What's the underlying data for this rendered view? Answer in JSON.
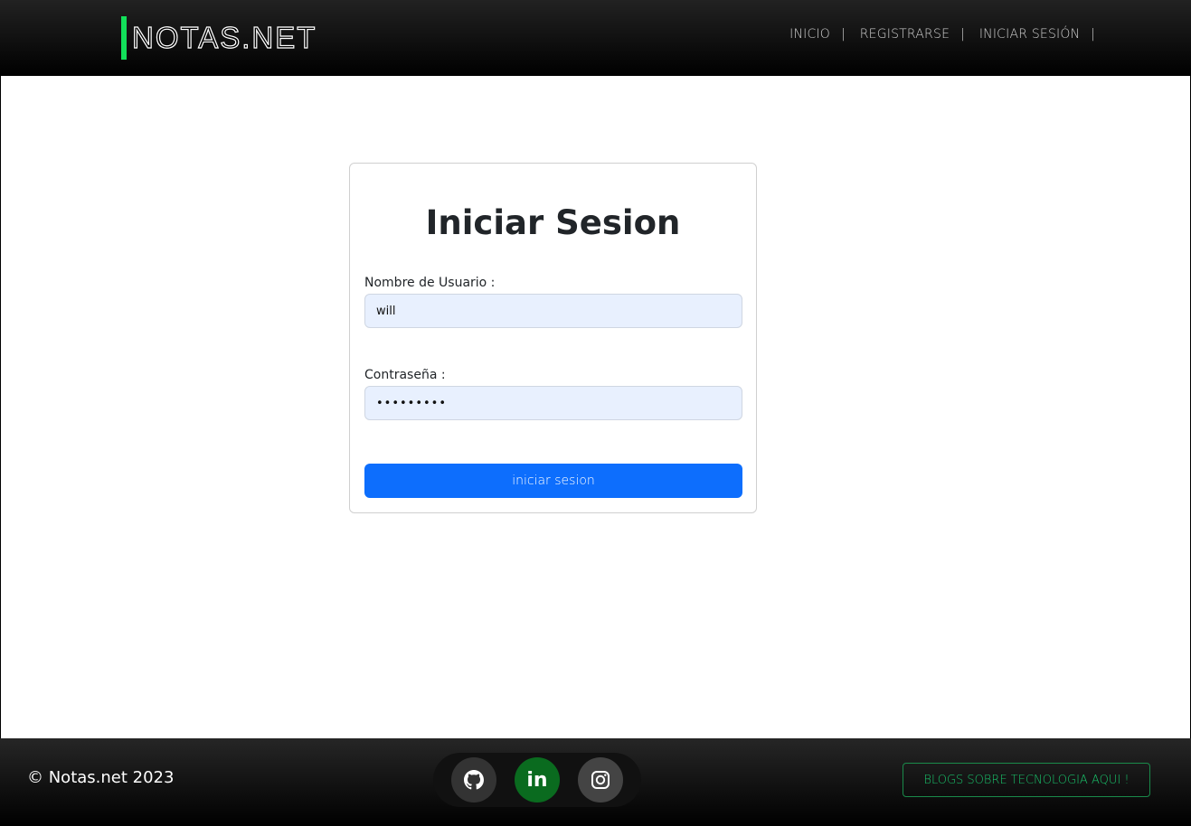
{
  "header": {
    "logo": "NOTAS.NET",
    "nav": [
      {
        "label": "INICIO"
      },
      {
        "label": "REGISTRARSE"
      },
      {
        "label": "INICIAR SESIÓN"
      }
    ],
    "separator": "|"
  },
  "login": {
    "title": "Iniciar Sesion",
    "username_label": "Nombre de Usuario :",
    "username_value": "will",
    "password_label": "Contraseña :",
    "password_value": "•••••••••",
    "submit_label": "iniciar sesion"
  },
  "footer": {
    "copyright": "© Notas.net 2023",
    "social": [
      {
        "icon": "github-icon"
      },
      {
        "icon": "linkedin-icon",
        "text": "in"
      },
      {
        "icon": "instagram-icon"
      }
    ],
    "blogs_label": "BLOGS SOBRE TECNOLOGIA AQUI !"
  },
  "colors": {
    "accent_green": "#12e05a",
    "primary_blue": "#0d6efd",
    "linkedin_bg": "#0a6b1f",
    "blogs_text": "#19c26a"
  }
}
